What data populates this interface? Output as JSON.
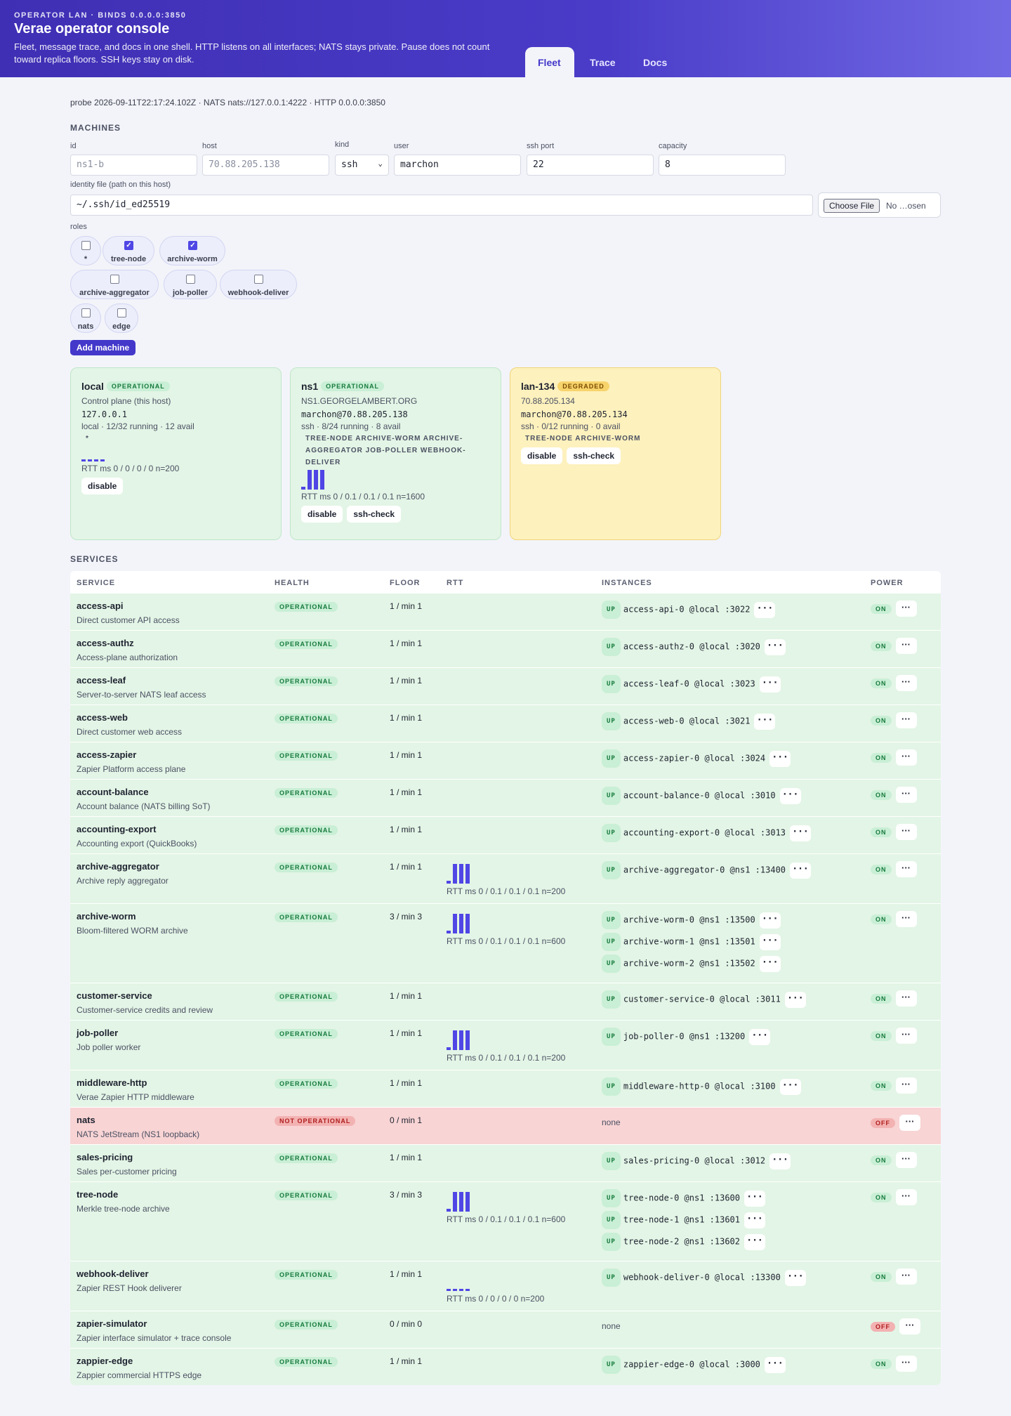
{
  "header": {
    "eyebrow": "OPERATOR LAN · BINDS 0.0.0.0:3850",
    "title": "Verae operator console",
    "subtitle": "Fleet, message trace, and docs in one shell. HTTP listens on all interfaces; NATS stays private. Pause does not count toward replica floors. SSH keys stay on disk.",
    "tabs": [
      "Fleet",
      "Trace",
      "Docs"
    ]
  },
  "probe": "probe 2026-09-11T22:17:24.102Z · NATS nats://127.0.0.1:4222 · HTTP 0.0.0.0:3850",
  "machines_title": "MACHINES",
  "form": {
    "id_label": "id",
    "id_placeholder": "ns1-b",
    "host_label": "host",
    "host_placeholder": "70.88.205.138",
    "kind_label": "kind",
    "kind_value": "ssh",
    "user_label": "user",
    "user_value": "marchon",
    "port_label": "ssh port",
    "port_value": "22",
    "cap_label": "capacity",
    "cap_value": "8",
    "identity_label": "identity file (path on this host)",
    "identity_value": "~/.ssh/id_ed25519",
    "choose_file": "Choose File",
    "no_file": "No …osen",
    "roles_label": "roles",
    "add_button": "Add machine"
  },
  "roles": [
    {
      "name": "*",
      "checked": false
    },
    {
      "name": "tree-node",
      "checked": true
    },
    {
      "name": "archive-worm",
      "checked": true
    },
    {
      "name": "archive-aggregator",
      "checked": false
    },
    {
      "name": "job-poller",
      "checked": false
    },
    {
      "name": "webhook-deliver",
      "checked": false
    },
    {
      "name": "nats",
      "checked": false
    },
    {
      "name": "edge",
      "checked": false
    }
  ],
  "machines": [
    {
      "name": "local",
      "status": "OPERATIONAL",
      "line1": "Control plane (this host)",
      "addr": "127.0.0.1",
      "line3": "local · 12/32 running · 12 avail",
      "roles": "*",
      "rtt": "RTT ms 0 / 0 / 0 / 0 n=200",
      "buttons": [
        "disable"
      ],
      "spark": [
        0.1,
        0.1,
        0.1,
        0.1
      ]
    },
    {
      "name": "ns1",
      "status": "OPERATIONAL",
      "line1": "NS1.GEORGELAMBERT.ORG",
      "addr": "marchon@70.88.205.138",
      "line3": "ssh · 8/24 running · 8 avail",
      "roles": "TREE-NODE   ARCHIVE-WORM   ARCHIVE-AGGREGATOR   JOB-POLLER   WEBHOOK-DELIVER",
      "rtt": "RTT ms 0 / 0.1 / 0.1 / 0.1 n=1600",
      "buttons": [
        "disable",
        "ssh-check"
      ],
      "spark": [
        0.15,
        1,
        1,
        1
      ]
    },
    {
      "name": "lan-134",
      "status": "DEGRADED",
      "line1": "70.88.205.134",
      "addr": "marchon@70.88.205.134",
      "line3": "ssh · 0/12 running · 0 avail",
      "roles": "TREE-NODE   ARCHIVE-WORM",
      "rtt": "",
      "buttons": [
        "disable",
        "ssh-check"
      ],
      "spark": []
    }
  ],
  "services_title": "SERVICES",
  "columns": [
    "SERVICE",
    "HEALTH",
    "FLOOR",
    "RTT",
    "INSTANCES",
    "POWER"
  ],
  "more_label": "···",
  "services": [
    {
      "name": "access-api",
      "desc": "Direct customer API access",
      "health": "OPERATIONAL",
      "floor": "1 / min 1",
      "rtt": "",
      "spark": [],
      "instances": [
        "access-api-0 @local :3022"
      ],
      "power": "ON"
    },
    {
      "name": "access-authz",
      "desc": "Access-plane authorization",
      "health": "OPERATIONAL",
      "floor": "1 / min 1",
      "rtt": "",
      "spark": [],
      "instances": [
        "access-authz-0 @local :3020"
      ],
      "power": "ON"
    },
    {
      "name": "access-leaf",
      "desc": "Server-to-server NATS leaf access",
      "health": "OPERATIONAL",
      "floor": "1 / min 1",
      "rtt": "",
      "spark": [],
      "instances": [
        "access-leaf-0 @local :3023"
      ],
      "power": "ON"
    },
    {
      "name": "access-web",
      "desc": "Direct customer web access",
      "health": "OPERATIONAL",
      "floor": "1 / min 1",
      "rtt": "",
      "spark": [],
      "instances": [
        "access-web-0 @local :3021"
      ],
      "power": "ON"
    },
    {
      "name": "access-zapier",
      "desc": "Zapier Platform access plane",
      "health": "OPERATIONAL",
      "floor": "1 / min 1",
      "rtt": "",
      "spark": [],
      "instances": [
        "access-zapier-0 @local :3024"
      ],
      "power": "ON"
    },
    {
      "name": "account-balance",
      "desc": "Account balance (NATS billing SoT)",
      "health": "OPERATIONAL",
      "floor": "1 / min 1",
      "rtt": "",
      "spark": [],
      "instances": [
        "account-balance-0 @local :3010"
      ],
      "power": "ON"
    },
    {
      "name": "accounting-export",
      "desc": "Accounting export (QuickBooks)",
      "health": "OPERATIONAL",
      "floor": "1 / min 1",
      "rtt": "",
      "spark": [],
      "instances": [
        "accounting-export-0 @local :3013"
      ],
      "power": "ON"
    },
    {
      "name": "archive-aggregator",
      "desc": "Archive reply aggregator",
      "health": "OPERATIONAL",
      "floor": "1 / min 1",
      "rtt": "RTT ms 0 / 0.1 / 0.1 / 0.1 n=200",
      "spark": [
        0.15,
        1,
        1,
        1
      ],
      "instances": [
        "archive-aggregator-0 @ns1 :13400"
      ],
      "power": "ON"
    },
    {
      "name": "archive-worm",
      "desc": "Bloom-filtered WORM archive",
      "health": "OPERATIONAL",
      "floor": "3 / min 3",
      "rtt": "RTT ms 0 / 0.1 / 0.1 / 0.1 n=600",
      "spark": [
        0.15,
        1,
        1,
        1
      ],
      "instances": [
        "archive-worm-0 @ns1 :13500",
        "archive-worm-1 @ns1 :13501",
        "archive-worm-2 @ns1 :13502"
      ],
      "power": "ON"
    },
    {
      "name": "customer-service",
      "desc": "Customer-service credits and review",
      "health": "OPERATIONAL",
      "floor": "1 / min 1",
      "rtt": "",
      "spark": [],
      "instances": [
        "customer-service-0 @local :3011"
      ],
      "power": "ON"
    },
    {
      "name": "job-poller",
      "desc": "Job poller worker",
      "health": "OPERATIONAL",
      "floor": "1 / min 1",
      "rtt": "RTT ms 0 / 0.1 / 0.1 / 0.1 n=200",
      "spark": [
        0.15,
        1,
        1,
        1
      ],
      "instances": [
        "job-poller-0 @ns1 :13200"
      ],
      "power": "ON"
    },
    {
      "name": "middleware-http",
      "desc": "Verae Zapier HTTP middleware",
      "health": "OPERATIONAL",
      "floor": "1 / min 1",
      "rtt": "",
      "spark": [],
      "instances": [
        "middleware-http-0 @local :3100"
      ],
      "power": "ON"
    },
    {
      "name": "nats",
      "desc": "NATS JetStream (NS1 loopback)",
      "health": "NOT OPERATIONAL",
      "floor": "0 / min 1",
      "rtt": "",
      "spark": [],
      "instances": [],
      "none": "none",
      "power": "OFF"
    },
    {
      "name": "sales-pricing",
      "desc": "Sales per-customer pricing",
      "health": "OPERATIONAL",
      "floor": "1 / min 1",
      "rtt": "",
      "spark": [],
      "instances": [
        "sales-pricing-0 @local :3012"
      ],
      "power": "ON"
    },
    {
      "name": "tree-node",
      "desc": "Merkle tree-node archive",
      "health": "OPERATIONAL",
      "floor": "3 / min 3",
      "rtt": "RTT ms 0 / 0.1 / 0.1 / 0.1 n=600",
      "spark": [
        0.15,
        1,
        1,
        1
      ],
      "instances": [
        "tree-node-0 @ns1 :13600",
        "tree-node-1 @ns1 :13601",
        "tree-node-2 @ns1 :13602"
      ],
      "power": "ON"
    },
    {
      "name": "webhook-deliver",
      "desc": "Zapier REST Hook deliverer",
      "health": "OPERATIONAL",
      "floor": "1 / min 1",
      "rtt": "RTT ms 0 / 0 / 0 / 0 n=200",
      "spark": [
        0.1,
        0.1,
        0.1,
        0.1
      ],
      "instances": [
        "webhook-deliver-0 @local :13300"
      ],
      "power": "ON"
    },
    {
      "name": "zapier-simulator",
      "desc": "Zapier interface simulator + trace console",
      "health": "OPERATIONAL",
      "floor": "0 / min 0",
      "rtt": "",
      "spark": [],
      "instances": [],
      "none": "none",
      "power": "OFF"
    },
    {
      "name": "zappier-edge",
      "desc": "Zappier commercial HTTPS edge",
      "health": "OPERATIONAL",
      "floor": "1 / min 1",
      "rtt": "",
      "spark": [],
      "instances": [
        "zappier-edge-0 @local :3000"
      ],
      "power": "ON"
    }
  ]
}
